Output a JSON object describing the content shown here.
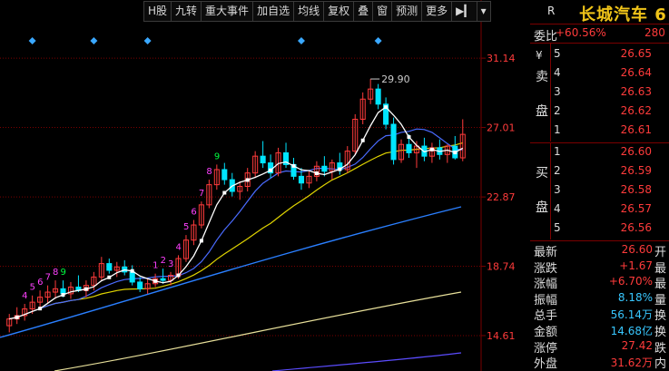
{
  "toolbar": {
    "items": [
      "H股",
      "九转",
      "重大事件",
      "加自选",
      "均线",
      "复权",
      "叠",
      "窗",
      "预测",
      "更多",
      "▶▎",
      "▾"
    ]
  },
  "stock": {
    "badge": "R",
    "name": "长城汽车 6"
  },
  "ratio": {
    "label": "委比",
    "value": "+60.56%",
    "extra": "280"
  },
  "sell_side": {
    "marker": "¥",
    "side_label_1": "卖",
    "side_label_2": "盘"
  },
  "buy_side": {
    "side_label_1": "买",
    "side_label_2": "盘"
  },
  "order_book": {
    "sells": [
      {
        "level": "5",
        "price": "26.65"
      },
      {
        "level": "4",
        "price": "26.64"
      },
      {
        "level": "3",
        "price": "26.63"
      },
      {
        "level": "2",
        "price": "26.62"
      },
      {
        "level": "1",
        "price": "26.61"
      }
    ],
    "buys": [
      {
        "level": "1",
        "price": "26.60"
      },
      {
        "level": "2",
        "price": "26.59"
      },
      {
        "level": "3",
        "price": "26.58"
      },
      {
        "level": "4",
        "price": "26.57"
      },
      {
        "level": "5",
        "price": "26.56"
      }
    ]
  },
  "stats": [
    {
      "label": "最新",
      "value": "26.60",
      "right": "开",
      "color": "red"
    },
    {
      "label": "涨跌",
      "value": "+1.67",
      "right": "最",
      "color": "red"
    },
    {
      "label": "涨幅",
      "value": "+6.70%",
      "right": "最",
      "color": "red"
    },
    {
      "label": "振幅",
      "value": "8.18%",
      "right": "量",
      "color": "cyan"
    },
    {
      "label": "总手",
      "value": "56.14万",
      "right": "换",
      "color": "cyan"
    },
    {
      "label": "金额",
      "value": "14.68亿",
      "right": "换",
      "color": "cyan"
    },
    {
      "label": "涨停",
      "value": "27.42",
      "right": "跌",
      "color": "red"
    },
    {
      "label": "外盘",
      "value": "31.62万",
      "right": "内",
      "color": "red"
    }
  ],
  "chart_data": {
    "type": "candlestick",
    "y_ticks": [
      "31.14",
      "27.01",
      "22.87",
      "18.74",
      "14.61"
    ],
    "ylim": [
      12.5,
      33.2
    ],
    "max_label": "29.90",
    "candles": [
      {
        "o": 15.2,
        "h": 15.9,
        "l": 14.8,
        "c": 15.6
      },
      {
        "o": 15.6,
        "h": 16.3,
        "l": 15.3,
        "c": 15.8
      },
      {
        "o": 15.8,
        "h": 16.5,
        "l": 15.5,
        "c": 16.2
      },
      {
        "o": 16.2,
        "h": 17.0,
        "l": 15.9,
        "c": 16.6
      },
      {
        "o": 16.6,
        "h": 17.3,
        "l": 16.3,
        "c": 16.9
      },
      {
        "o": 16.9,
        "h": 17.6,
        "l": 16.5,
        "c": 17.2
      },
      {
        "o": 17.2,
        "h": 17.9,
        "l": 16.8,
        "c": 17.4
      },
      {
        "o": 17.4,
        "h": 17.9,
        "l": 16.9,
        "c": 17.1
      },
      {
        "o": 17.1,
        "h": 17.8,
        "l": 16.8,
        "c": 17.5
      },
      {
        "o": 17.5,
        "h": 18.2,
        "l": 17.2,
        "c": 17.3
      },
      {
        "o": 17.3,
        "h": 17.9,
        "l": 16.9,
        "c": 17.6
      },
      {
        "o": 17.6,
        "h": 18.4,
        "l": 17.3,
        "c": 18.1
      },
      {
        "o": 18.1,
        "h": 19.3,
        "l": 17.9,
        "c": 18.9
      },
      {
        "o": 18.9,
        "h": 19.2,
        "l": 18.3,
        "c": 18.5
      },
      {
        "o": 18.5,
        "h": 19.0,
        "l": 18.1,
        "c": 18.7
      },
      {
        "o": 18.7,
        "h": 19.1,
        "l": 18.2,
        "c": 18.4
      },
      {
        "o": 18.4,
        "h": 18.8,
        "l": 17.6,
        "c": 17.8
      },
      {
        "o": 17.8,
        "h": 18.1,
        "l": 17.2,
        "c": 17.4
      },
      {
        "o": 17.4,
        "h": 18.0,
        "l": 17.1,
        "c": 17.7
      },
      {
        "o": 17.7,
        "h": 18.3,
        "l": 17.5,
        "c": 18.0
      },
      {
        "o": 18.0,
        "h": 18.6,
        "l": 17.7,
        "c": 17.9
      },
      {
        "o": 17.9,
        "h": 18.4,
        "l": 17.6,
        "c": 18.2
      },
      {
        "o": 18.2,
        "h": 19.4,
        "l": 18.0,
        "c": 19.2
      },
      {
        "o": 19.2,
        "h": 20.6,
        "l": 19.0,
        "c": 20.3
      },
      {
        "o": 20.3,
        "h": 21.5,
        "l": 20.0,
        "c": 21.2
      },
      {
        "o": 21.2,
        "h": 22.6,
        "l": 21.0,
        "c": 22.4
      },
      {
        "o": 22.4,
        "h": 23.9,
        "l": 22.2,
        "c": 23.6
      },
      {
        "o": 23.6,
        "h": 24.8,
        "l": 23.3,
        "c": 24.5
      },
      {
        "o": 24.5,
        "h": 24.9,
        "l": 23.6,
        "c": 23.9
      },
      {
        "o": 23.9,
        "h": 24.3,
        "l": 22.9,
        "c": 23.2
      },
      {
        "o": 23.2,
        "h": 23.8,
        "l": 22.7,
        "c": 23.5
      },
      {
        "o": 23.5,
        "h": 24.6,
        "l": 23.2,
        "c": 24.3
      },
      {
        "o": 24.3,
        "h": 25.6,
        "l": 24.0,
        "c": 25.3
      },
      {
        "o": 25.3,
        "h": 26.2,
        "l": 24.6,
        "c": 24.9
      },
      {
        "o": 24.9,
        "h": 25.4,
        "l": 24.0,
        "c": 24.3
      },
      {
        "o": 24.3,
        "h": 25.8,
        "l": 24.1,
        "c": 25.5
      },
      {
        "o": 25.5,
        "h": 26.1,
        "l": 24.6,
        "c": 24.8
      },
      {
        "o": 24.8,
        "h": 25.2,
        "l": 23.9,
        "c": 24.1
      },
      {
        "o": 24.1,
        "h": 24.6,
        "l": 23.3,
        "c": 23.7
      },
      {
        "o": 23.7,
        "h": 24.4,
        "l": 23.4,
        "c": 24.1
      },
      {
        "o": 24.1,
        "h": 25.0,
        "l": 23.8,
        "c": 24.7
      },
      {
        "o": 24.7,
        "h": 25.3,
        "l": 24.1,
        "c": 24.4
      },
      {
        "o": 24.4,
        "h": 25.1,
        "l": 23.9,
        "c": 24.9
      },
      {
        "o": 24.9,
        "h": 25.5,
        "l": 24.2,
        "c": 24.5
      },
      {
        "o": 24.5,
        "h": 25.9,
        "l": 24.3,
        "c": 25.6
      },
      {
        "o": 25.6,
        "h": 27.8,
        "l": 25.4,
        "c": 27.5
      },
      {
        "o": 27.5,
        "h": 29.1,
        "l": 27.2,
        "c": 28.7
      },
      {
        "o": 28.7,
        "h": 29.9,
        "l": 28.4,
        "c": 29.3
      },
      {
        "o": 29.3,
        "h": 29.6,
        "l": 28.1,
        "c": 28.4
      },
      {
        "o": 28.4,
        "h": 28.8,
        "l": 26.9,
        "c": 27.2
      },
      {
        "o": 27.2,
        "h": 27.6,
        "l": 24.8,
        "c": 25.1
      },
      {
        "o": 25.1,
        "h": 26.3,
        "l": 24.9,
        "c": 26.0
      },
      {
        "o": 26.0,
        "h": 26.6,
        "l": 25.2,
        "c": 25.5
      },
      {
        "o": 25.5,
        "h": 26.2,
        "l": 24.6,
        "c": 25.9
      },
      {
        "o": 25.9,
        "h": 26.4,
        "l": 25.0,
        "c": 25.3
      },
      {
        "o": 25.3,
        "h": 26.1,
        "l": 24.9,
        "c": 25.8
      },
      {
        "o": 25.8,
        "h": 26.3,
        "l": 25.1,
        "c": 25.4
      },
      {
        "o": 25.4,
        "h": 26.0,
        "l": 24.9,
        "c": 25.9
      },
      {
        "o": 25.9,
        "h": 26.5,
        "l": 25.1,
        "c": 25.2
      },
      {
        "o": 25.2,
        "h": 27.5,
        "l": 25.0,
        "c": 26.6
      }
    ],
    "td_labels": [
      {
        "i": 2,
        "t": "4",
        "up": true
      },
      {
        "i": 3,
        "t": "5",
        "up": true
      },
      {
        "i": 4,
        "t": "6",
        "up": true
      },
      {
        "i": 5,
        "t": "7",
        "up": true
      },
      {
        "i": 6,
        "t": "8",
        "up": true
      },
      {
        "i": 7,
        "t": "9",
        "up": false
      },
      {
        "i": 19,
        "t": "1",
        "up": true
      },
      {
        "i": 20,
        "t": "2",
        "up": true
      },
      {
        "i": 21,
        "t": "3",
        "up": true
      },
      {
        "i": 22,
        "t": "4",
        "up": true
      },
      {
        "i": 23,
        "t": "5",
        "up": true
      },
      {
        "i": 24,
        "t": "6",
        "up": true
      },
      {
        "i": 25,
        "t": "7",
        "up": true
      },
      {
        "i": 26,
        "t": "8",
        "up": true
      },
      {
        "i": 27,
        "t": "9",
        "up": false
      }
    ],
    "event_markers": [
      3,
      11,
      18,
      38,
      48
    ]
  },
  "colors": {
    "up": "#ff3b3b",
    "down": "#00e5ff",
    "ma5": "#ffffff",
    "ma10": "#4a6bff",
    "ma20": "#e0d400",
    "ma60": "#2a7fff",
    "ma120": "#e8e09a",
    "ma250": "#5b4cff",
    "grid": "#7a0000",
    "axis_text": "#ff3b3b",
    "marker": "#3aa8ff",
    "td_up": "#ff40ff",
    "td_down": "#00ff40"
  }
}
